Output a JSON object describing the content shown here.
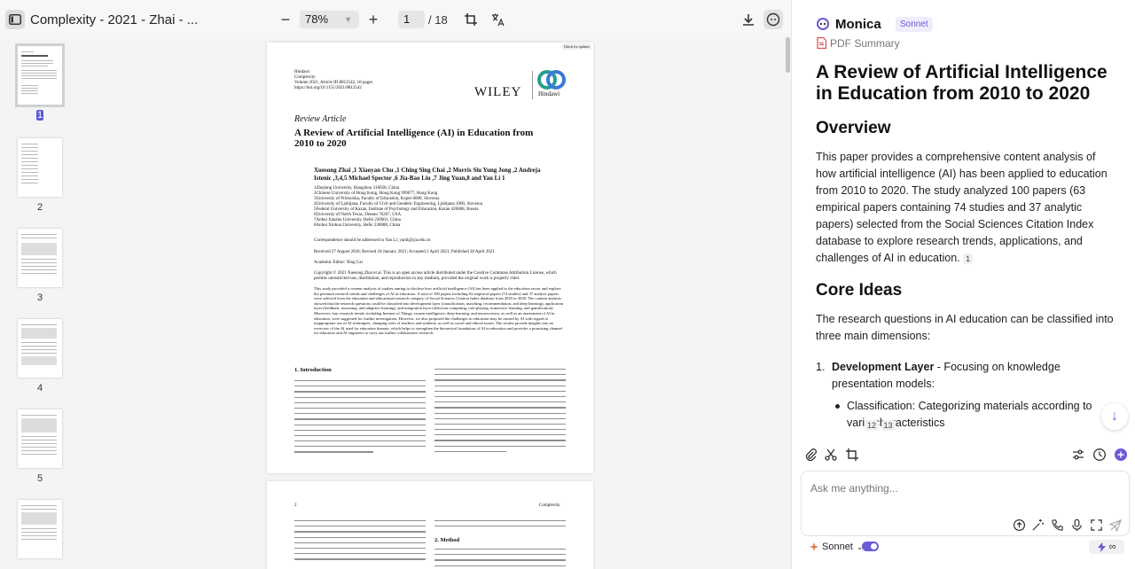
{
  "toolbar": {
    "doc_title": "Complexity - 2021 - Zhai - ...",
    "zoom": "78%",
    "page_current": "1",
    "page_total": "/ 18"
  },
  "thumbnails": [
    {
      "label": "1",
      "selected": true
    },
    {
      "label": "2",
      "selected": false
    },
    {
      "label": "3",
      "selected": false
    },
    {
      "label": "4",
      "selected": false
    },
    {
      "label": "5",
      "selected": false
    }
  ],
  "page1": {
    "check_updates": "Check for updates",
    "header_lines": [
      "Hindawi",
      "Complexity",
      "Volume 2021, Article ID 8812542, 18 pages",
      "https://doi.org/10.1155/2021/8812542"
    ],
    "publisher": "WILEY",
    "publisher2": "Hindawi",
    "article_type": "Review Article",
    "title": "A Review of Artificial Intelligence (AI) in Education from 2010 to 2020",
    "authors": "Xuesong Zhai ,1 Xiaoyan Chu ,1 Ching Sing Chai ,2 Morris Siu Yung Jong ,2 Andreja Istenic ,3,4,5 Michael Spector ,6 Jia-Bao Liu ,7 Jing Yuan,8 and Yan Li 1",
    "affiliations": [
      "1Zhejiang University, Hangzhou 310058, China",
      "2Chinese University of Hong Kong, Hong Kong 999077, Hong Kong",
      "3University of Primorska, Faculty of Education, Koper 6000, Slovenia",
      "4University of Ljubljana, Faculty of Civil and Geodetic Engineering, Ljubljana 1000, Slovenia",
      "5Federal University of Kazan, Institute of Psychology and Education, Kazan 420008, Russia",
      "6University of North Texas, Denton 76207, USA",
      "7Anhui Jianzhu University, Hefei 230601, China",
      "8Anhui Xinhua University, Hefei 230088, China"
    ],
    "correspondence": "Correspondence should be addressed to Yan Li; yanli@zju.edu.cn",
    "dates": "Received 27 August 2020; Revised 18 January 2021; Accepted 2 April 2021; Published 20 April 2021",
    "editor": "Academic Editor: Ning Cai",
    "copyright": "Copyright © 2021 Xuesong Zhai et al. This is an open access article distributed under the Creative Commons Attribution License, which permits unrestricted use, distribution, and reproduction in any medium, provided the original work is properly cited.",
    "abstract": "This study provided a content analysis of studies aiming to disclose how artificial intelligence (AI) has been applied to the education sector and explore the potential research trends and challenges of AI in education. A total of 100 papers including 63 empirical papers (74 studies) and 37 analytic papers were selected from the education and educational research category of Social Sciences Citation Index database from 2010 to 2020. The content analysis showed that the research questions could be classified into development layer (classification, matching, recommendation, and deep learning), application layer (feedback, reasoning, and adaptive learning), and integration layer (affection computing, role-playing, immersive learning, and gamification). Moreover, four research trends, including Internet of Things, swarm intelligence, deep learning, and neuroscience, as well as an assessment of AI in education, were suggested for further investigation. However, we also proposed the challenges in education may be caused by AI with regard to inappropriate use of AI techniques, changing roles of teachers and students, as well as social and ethical issues. The results provide insights into an overview of the AI used for education domain, which helps to strengthen the theoretical foundation of AI in education and provides a promising channel for educators and AI engineers to carry out further collaborative research.",
    "section1": "1. Introduction"
  },
  "page2": {
    "page_number": "2",
    "running_head": "Complexity",
    "section2": "2. Method"
  },
  "panel": {
    "brand": "Monica",
    "model_badge": "Sonnet",
    "pdf_summary": "PDF Summary",
    "title": "A Review of Artificial Intelligence in Education from 2010 to 2020",
    "overview_heading": "Overview",
    "overview_text": "This paper provides a comprehensive content analysis of how artificial intelligence (AI) has been applied to education from 2010 to 2020. The study analyzed 100 papers (63 empirical papers containing 74 studies and 37 analytic papers) selected from the Social Sciences Citation Index database to explore research trends, applications, and challenges of AI in education.",
    "overview_cite": "1",
    "core_heading": "Core Ideas",
    "core_text": "The research questions in AI education can be classified into three main dimensions:",
    "list_num": "1.",
    "list_bold": "Development Layer",
    "list_rest": " - Focusing on knowledge presentation models:",
    "bullet_text": "Classification: Categorizing materials according to vario characteristics",
    "bullet_cite1": "12",
    "bullet_cite2": "13",
    "input_placeholder": "Ask me anything...",
    "footer_model": "Sonnet",
    "footer_right_icon": "∞"
  },
  "colors": {
    "accent": "#6b5bd6",
    "pdf_red": "#e0454a"
  }
}
